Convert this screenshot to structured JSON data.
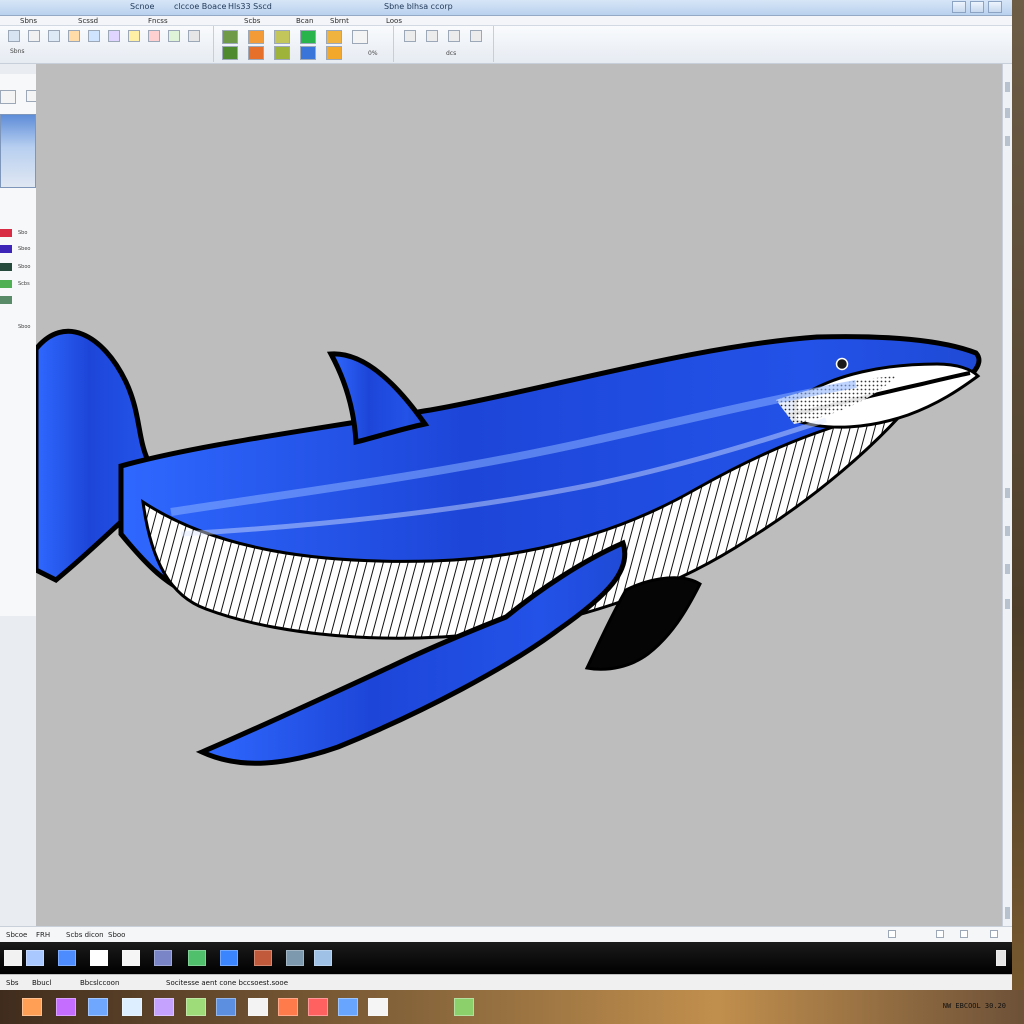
{
  "window": {
    "title_center": "Sbne blhsa ccorp",
    "title_left_1": "Scnoe",
    "title_left_2": "clccoe  Boace",
    "title_left_3": "Hls33 Sscd"
  },
  "menu": {
    "items": [
      "Sbns",
      "Scssd",
      "Fncss",
      "Scbs",
      "Bcan",
      "Sbrnt",
      "Loos"
    ]
  },
  "ribbon": {
    "labels": [
      "Sbns",
      "0%",
      "dcs"
    ]
  },
  "left_panel": {
    "labels": [
      "Sbo",
      "Sbeo",
      "Sboo",
      "Scbs",
      "Sboo"
    ]
  },
  "status": {
    "left_1": "Sbcoe",
    "left_2": "FRH",
    "left_3": "Scbs dicon",
    "left_4": "Sboo"
  },
  "bottom_strip": {
    "item_1": "Sbs",
    "item_2": "Bbucl",
    "item_3": "Bbcslccoon",
    "item_4": "Socitesse aent cone bccsoest.sooe",
    "clock": "NW EBCOOL 30.20"
  },
  "colors": {
    "canvas": "#bdbdbd",
    "window": "#e9ecf1",
    "accent_blue": "#2b5ce6",
    "taskbar": "#000000"
  },
  "icons": {
    "close": "close-icon",
    "minimize": "minimize-icon",
    "restore": "restore-icon"
  }
}
